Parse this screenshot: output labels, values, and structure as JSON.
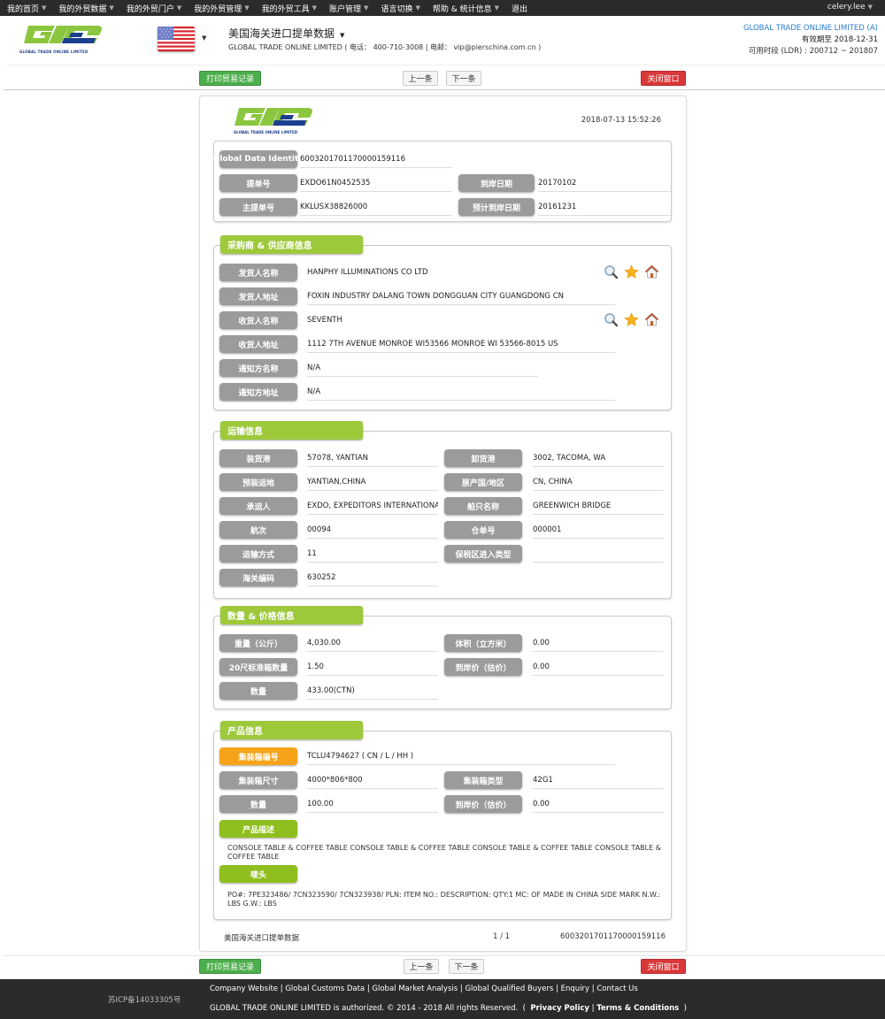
{
  "topnav": {
    "items": [
      "我的首页",
      "我的外贸数据",
      "我的外贸门户",
      "我的外贸管理",
      "我的外贸工具",
      "账户管理",
      "语言切换",
      "帮助 & 统计信息",
      "退出"
    ],
    "user": "celery.lee"
  },
  "header": {
    "logo_text": "GLOBAL TRADE ONLINE LIMITED",
    "title": "美国海关进口提单数据",
    "subtitle": "GLOBAL TRADE ONLINE LIMITED ( 电话： 400-710-3008 | 电邮： vip@pierschina.com.cn )",
    "company": "GLOBAL TRADE ONLINE LIMITED (A)",
    "valid_label": "有效期至",
    "valid_date": "2018-12-31",
    "ldr_label": "可用时段 (LDR) :",
    "ldr_range": "200712 ~ 201807"
  },
  "toolbar": {
    "print": "打印贸易记录",
    "prev": "上一条",
    "next": "下一条",
    "close": "关闭窗口"
  },
  "record": {
    "logo_text": "GLOBAL TRADE ONLINE LIMITED",
    "timestamp": "2018-07-13 15:52:26",
    "identity": {
      "gdi_label": "Global Data Identity",
      "gdi_value": "6003201701170000159116",
      "bl_label": "提单号",
      "bl_value": "EXDO61N0452535",
      "arrival_label": "到岸日期",
      "arrival_value": "20170102",
      "master_bl_label": "主提单号",
      "master_bl_value": "KKLUSX38826000",
      "est_arrival_label": "预计到岸日期",
      "est_arrival_value": "20161231"
    },
    "parties": {
      "title": "采购商 & 供应商信息",
      "shipper_name_label": "发货人名称",
      "shipper_name": "HANPHY ILLUMINATIONS CO LTD",
      "shipper_addr_label": "发货人地址",
      "shipper_addr": " FOXIN INDUSTRY DALANG TOWN DONGGUAN CITY GUANGDONG CN",
      "consignee_name_label": "收货人名称",
      "consignee_name": "SEVENTH",
      "consignee_addr_label": "收货人地址",
      "consignee_addr": "1112 7TH AVENUE MONROE WI53566 MONROE WI 53566-8015 US",
      "notify_name_label": "通知方名称",
      "notify_name": "N/A",
      "notify_addr_label": "通知方地址",
      "notify_addr": "N/A"
    },
    "transport": {
      "title": "运输信息",
      "load_port_label": "装货港",
      "load_port": "57078, YANTIAN",
      "unload_port_label": "卸货港",
      "unload_port": "3002, TACOMA, WA",
      "pre_carriage_label": "预装运地",
      "pre_carriage": "YANTIAN,CHINA",
      "origin_label": "原产国/地区",
      "origin": "CN, CHINA",
      "carrier_label": "承运人",
      "carrier": "EXDO, EXPEDITORS INTERNATIONAL",
      "vessel_label": "船只名称",
      "vessel": "GREENWICH BRIDGE",
      "voyage_label": "航次",
      "voyage": "00094",
      "warehouse_label": "仓单号",
      "warehouse": "000001",
      "mode_label": "运输方式",
      "mode": "11",
      "bonded_label": "保税区进入类型",
      "bonded": "",
      "customs_label": "海关编码",
      "customs": "630252"
    },
    "quantity": {
      "title": "数量 & 价格信息",
      "weight_label": "重量（公斤）",
      "weight": "4,030.00",
      "volume_label": "体积（立方米）",
      "volume": "0.00",
      "teu_label": "20尺标准箱数量",
      "teu": "1.50",
      "value_label": "到岸价（估价）",
      "value": "0.00",
      "qty_label": "数量",
      "qty": "433.00(CTN)"
    },
    "product": {
      "title": "产品信息",
      "container_no_label": "集装箱编号",
      "container_no": "TCLU4794627 ( CN / L / HH )",
      "container_size_label": "集装箱尺寸",
      "container_size": "4000*806*800",
      "container_type_label": "集装箱类型",
      "container_type": "42G1",
      "qty_label": "数量",
      "qty": "100.00",
      "value_label": "到岸价（估价）",
      "value": "0.00",
      "desc_label": "产品描述",
      "desc": "CONSOLE TABLE & COFFEE TABLE CONSOLE TABLE & COFFEE TABLE CONSOLE TABLE & COFFEE TABLE CONSOLE TABLE & COFFEE TABLE",
      "marks_label": "唛头",
      "marks": "PO#: 7PE323486/ 7CN323590/ 7CN323938/ PLN: ITEM NO.: DESCRIPTION: QTY:1 MC: OF MADE IN CHINA SIDE MARK N.W.: LBS G.W.: LBS"
    },
    "footer": {
      "source": "美国海关进口提单数据",
      "page": "1 / 1",
      "id": "6003201701170000159116"
    }
  },
  "footer": {
    "icp": "苏ICP备14033305号",
    "links": [
      "Company Website",
      "Global Customs Data",
      "Global Market Analysis",
      "Global Qualified Buyers",
      "Enquiry",
      "Contact Us"
    ],
    "copyright": "GLOBAL TRADE ONLINE LIMITED is authorized. © 2014 - 2018 All rights Reserved.",
    "privacy": "Privacy Policy",
    "terms": "Terms & Conditions"
  },
  "colors": {
    "brand_green": "#8cc63f",
    "brand_blue": "#1c3f8f",
    "section_tab": "#9dc93a",
    "label_pill": "#9b9b9b",
    "highlight_pill": "#f7a319",
    "print_button": "#4cae4c",
    "close_button": "#d9383a"
  }
}
